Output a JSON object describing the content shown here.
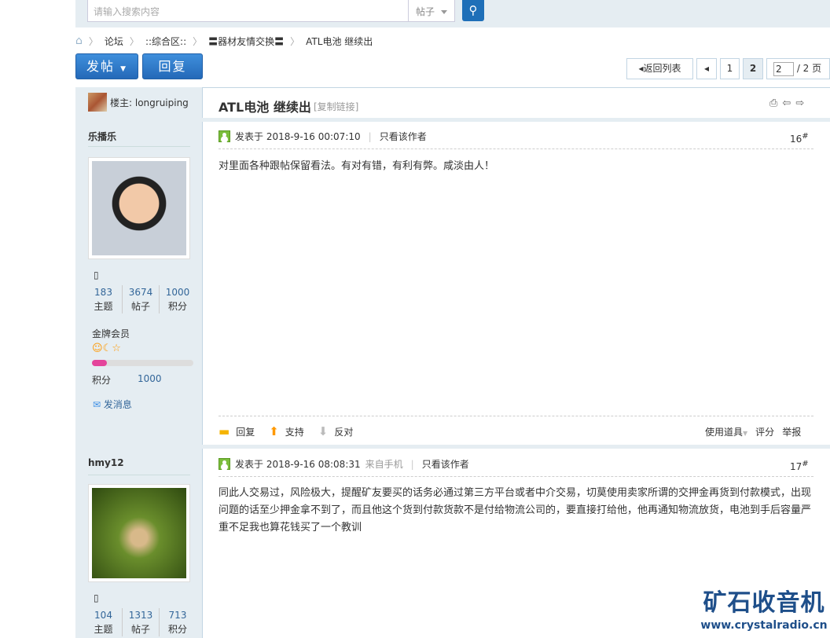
{
  "search": {
    "placeholder": "请输入搜索内容",
    "type": "帖子"
  },
  "breadcrumb": [
    "论坛",
    "::综合区::",
    "〓器材友情交换〓",
    "ATL电池 继续出"
  ],
  "toolbar": {
    "post": "发帖",
    "reply": "回复"
  },
  "pager": {
    "back": "返回列表",
    "pages": [
      "1",
      "2"
    ],
    "current": "2",
    "total": "/ 2 页"
  },
  "thread": {
    "starter": "楼主: longruiping",
    "title": "ATL电池 继续出",
    "copy": "[复制链接]"
  },
  "posts": [
    {
      "author": "乐播乐",
      "stats": [
        {
          "n": "183",
          "l": "主题"
        },
        {
          "n": "3674",
          "l": "帖子"
        },
        {
          "n": "1000",
          "l": "积分"
        }
      ],
      "rank": "金牌会员",
      "progress": 0.15,
      "score_label": "积分",
      "score": "1000",
      "msg": "发消息",
      "time": "发表于 2018-9-16 00:07:10",
      "mobile": "",
      "only": "只看该作者",
      "floor": "16",
      "sup": "#",
      "text": "对里面各种跟帖保留看法。有对有错，有利有弊。咸淡由人！",
      "actions": {
        "reply": "回复",
        "support": "支持",
        "oppose": "反对",
        "tools": "使用道具",
        "rate": "评分",
        "report": "举报"
      }
    },
    {
      "author": "hmy12",
      "stats": [
        {
          "n": "104",
          "l": "主题"
        },
        {
          "n": "1313",
          "l": "帖子"
        },
        {
          "n": "713",
          "l": "积分"
        }
      ],
      "time": "发表于 2018-9-16 08:08:31",
      "mobile": "来自手机",
      "only": "只看该作者",
      "floor": "17",
      "sup": "#",
      "text": "同此人交易过，风险极大，提醒矿友要买的话务必通过第三方平台或者中介交易，切莫使用卖家所谓的交押金再货到付款模式，出现问题的话至少押金拿不到了，而且他这个货到付款货款不是付给物流公司的，要直接打给他，他再通知物流放货，电池到手后容量严重不足我也算花钱买了一个教训"
    }
  ],
  "watermark": {
    "title": "矿石收音机",
    "url": "www.crystalradio.cn"
  }
}
